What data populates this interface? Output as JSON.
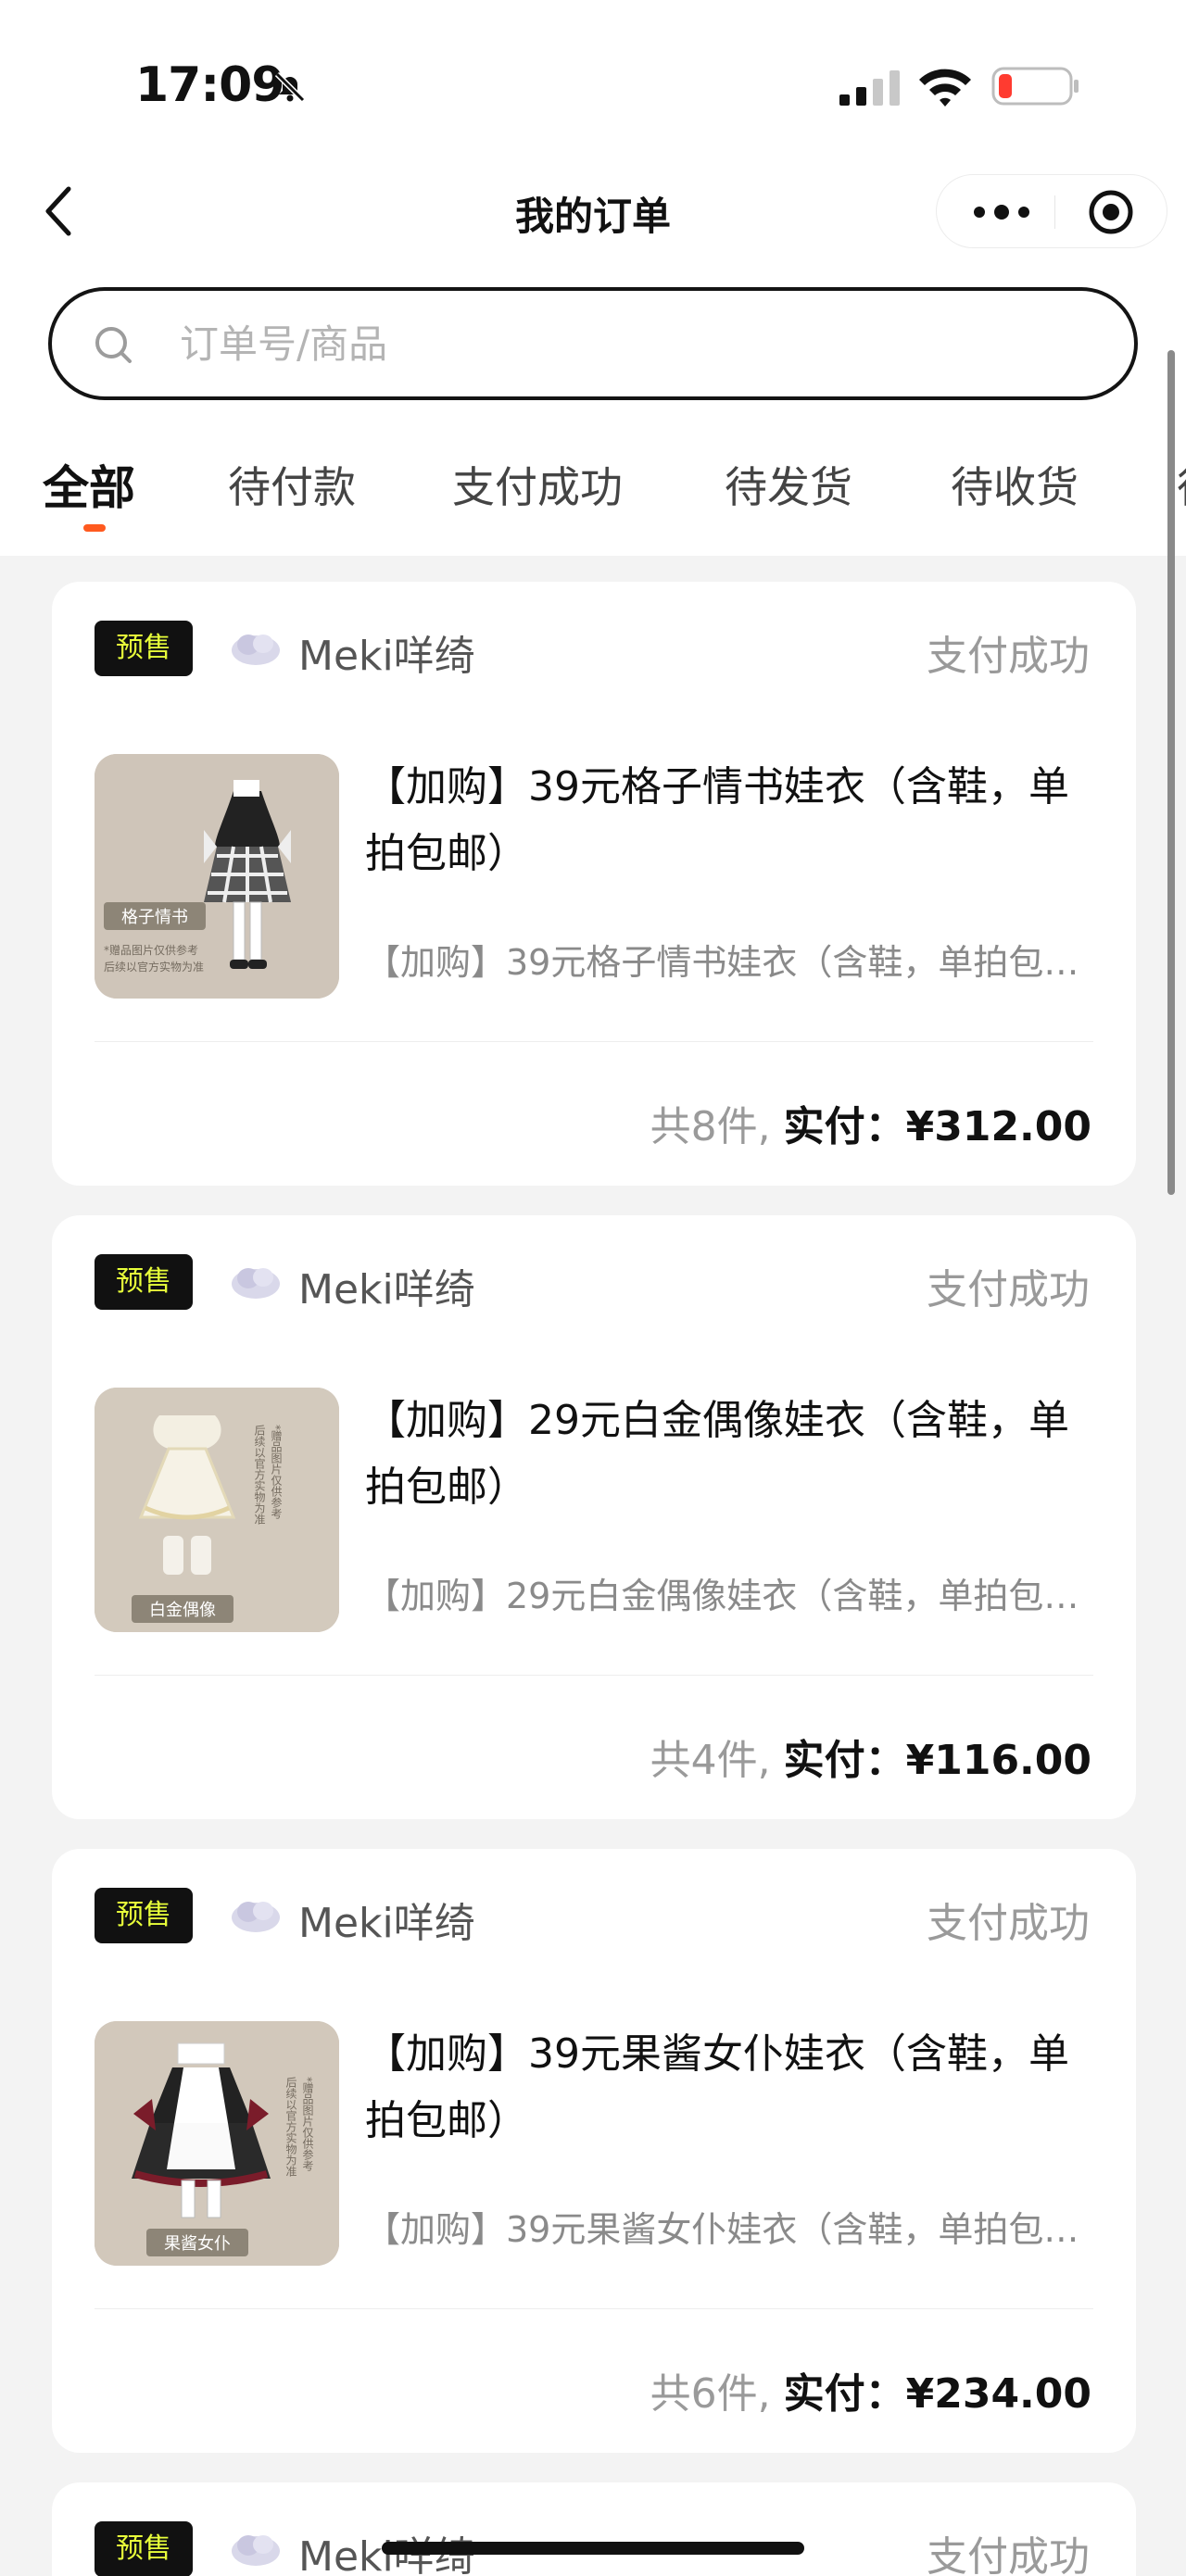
{
  "status_bar": {
    "time": "17:09"
  },
  "nav": {
    "title": "我的订单"
  },
  "search": {
    "placeholder": "订单号/商品"
  },
  "tabs": [
    {
      "label": "全部",
      "active": true
    },
    {
      "label": "待付款"
    },
    {
      "label": "支付成功"
    },
    {
      "label": "待发货"
    },
    {
      "label": "待收货"
    },
    {
      "label": "待"
    }
  ],
  "orders": [
    {
      "badge": "预售",
      "shop": "Meki咩绮",
      "status": "支付成功",
      "title": "【加购】39元格子情书娃衣（含鞋，单拍包邮）",
      "spec": "【加购】39元格子情书娃衣（含鞋，单拍包邮）",
      "thumb_caption": "格子情书",
      "thumb_note": "*赠品图片仅供参考 后续以官方实物为准",
      "count": "共8件,",
      "paid_label": "实付：",
      "amount": "¥312.00"
    },
    {
      "badge": "预售",
      "shop": "Meki咩绮",
      "status": "支付成功",
      "title": "【加购】29元白金偶像娃衣（含鞋，单拍包邮）",
      "spec": "【加购】29元白金偶像娃衣（含鞋，单拍包邮）",
      "thumb_caption": "白金偶像",
      "thumb_note": "*赠品图片仅供参考 后续以官方实物为准",
      "count": "共4件,",
      "paid_label": "实付：",
      "amount": "¥116.00"
    },
    {
      "badge": "预售",
      "shop": "Meki咩绮",
      "status": "支付成功",
      "title": "【加购】39元果酱女仆娃衣（含鞋，单拍包邮）",
      "spec": "【加购】39元果酱女仆娃衣（含鞋，单拍包邮）",
      "thumb_caption": "果酱女仆",
      "thumb_note": "*赠品图片仅供参考 后续以官方实物为准",
      "count": "共6件,",
      "paid_label": "实付：",
      "amount": "¥234.00"
    },
    {
      "badge": "预售",
      "shop": "Meki咩绮",
      "status": "支付成功"
    }
  ],
  "colors": {
    "accent": "#ff5a1f",
    "badge_bg": "#111111",
    "badge_text": "#e8ff3a",
    "page_bg": "#f3f3f3"
  }
}
